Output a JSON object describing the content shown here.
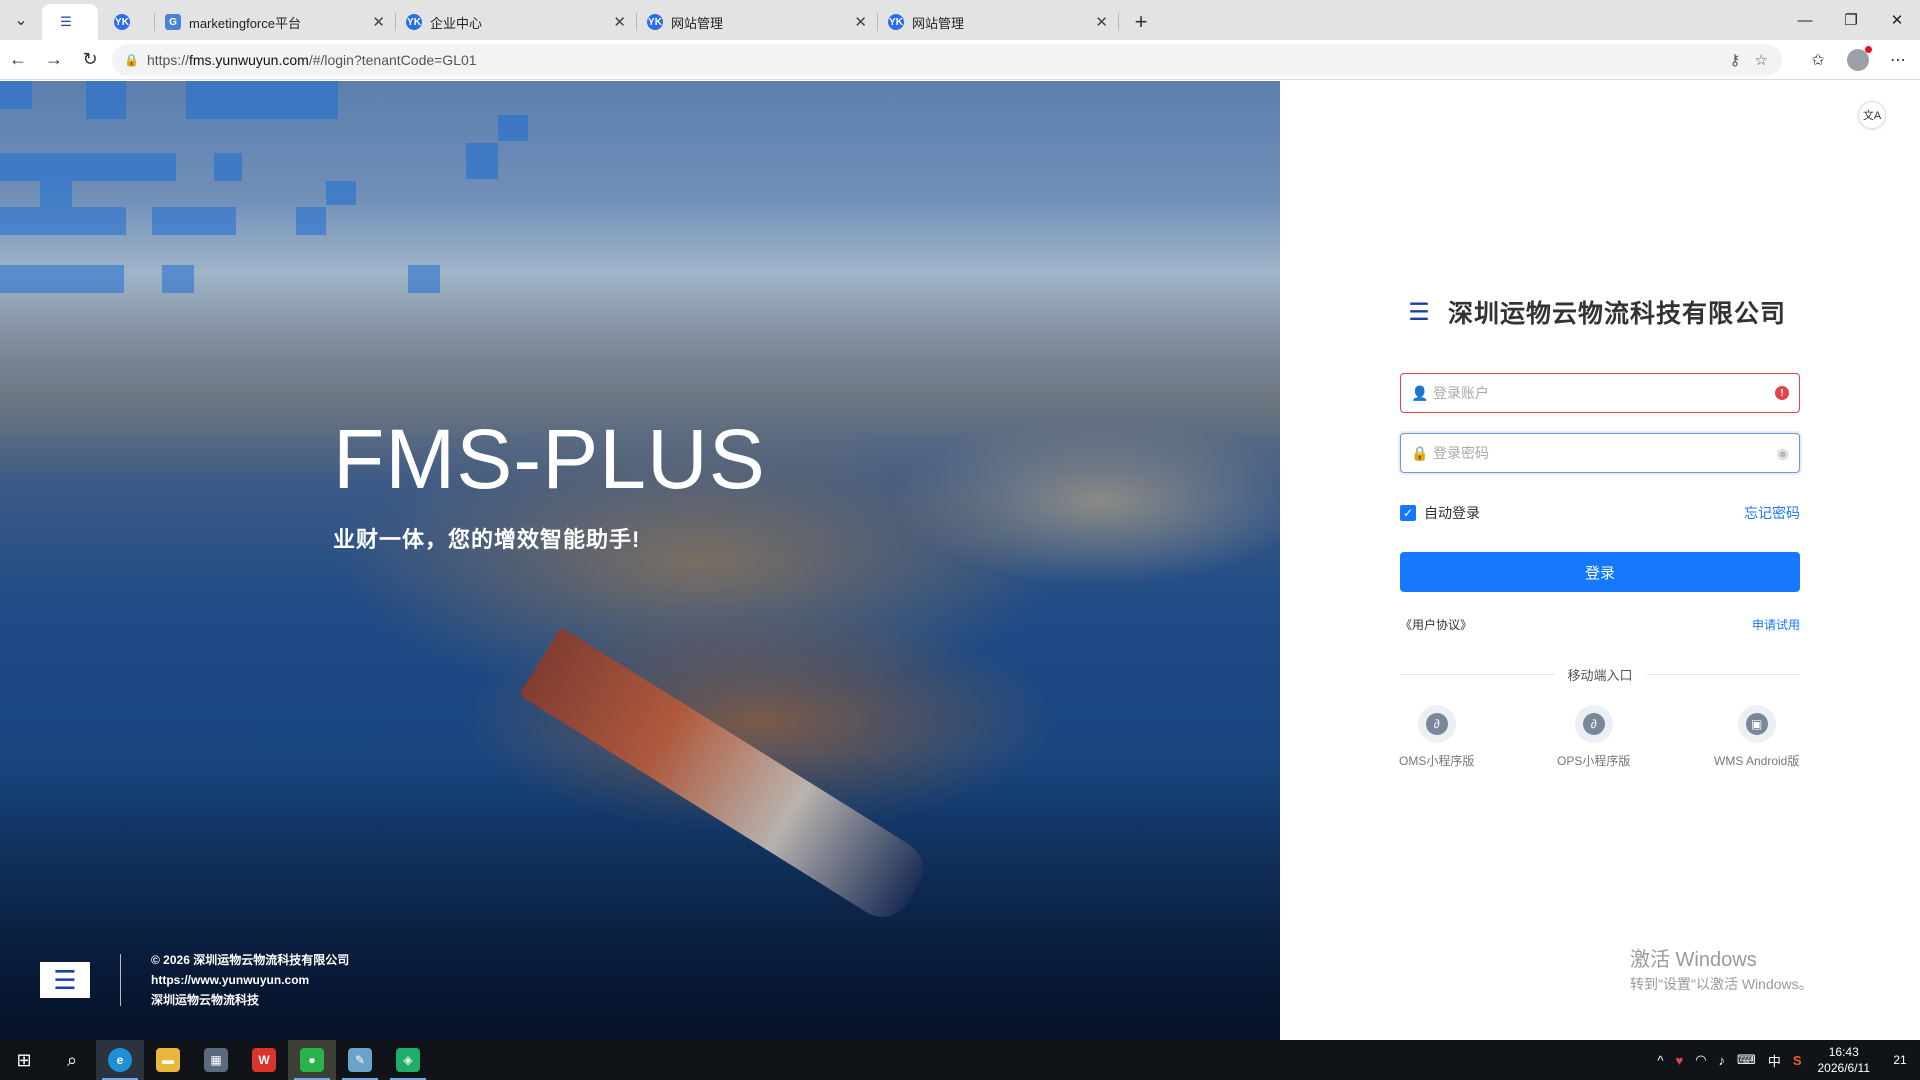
{
  "browser": {
    "tabs": [
      {
        "label": "",
        "favicon": "fms-logo-icon",
        "active": true
      },
      {
        "label": "",
        "favicon": "yk-logo-icon",
        "active": false
      },
      {
        "label": "marketingforce平台",
        "favicon": "gr-logo-icon",
        "active": false
      },
      {
        "label": "企业中心",
        "favicon": "yk-logo-icon",
        "active": false
      },
      {
        "label": "网站管理",
        "favicon": "yk-logo-icon",
        "active": false
      },
      {
        "label": "网站管理",
        "favicon": "yk-logo-icon",
        "active": false
      }
    ],
    "url_prefix": "https://",
    "url_host": "fms.yunwuyun.com",
    "url_path": "/#/login?tenantCode=GL01"
  },
  "hero": {
    "title": "FMS-PLUS",
    "subtitle": "业财一体，您的增效智能助手!",
    "footer": {
      "copyright": "© 2026 深圳运物云物流科技有限公司",
      "website": "https://www.yunwuyun.com",
      "company_short": "深圳运物云物流科技"
    }
  },
  "login": {
    "company_name": "深圳运物云物流科技有限公司",
    "account_placeholder": "登录账户",
    "password_placeholder": "登录密码",
    "remember_label": "自动登录",
    "remember_checked": true,
    "forgot_label": "忘记密码",
    "submit_label": "登录",
    "agreement_label": "《用户协议》",
    "trial_label": "申请试用",
    "mobile_section_label": "移动端入口",
    "mobile_entries": [
      {
        "label": "OMS小程序版",
        "icon": "mini-program-icon"
      },
      {
        "label": "OPS小程序版",
        "icon": "mini-program-icon"
      },
      {
        "label": "WMS Android版",
        "icon": "android-icon"
      }
    ],
    "accent_color": "#1677ff",
    "error_color": "#e0444d"
  },
  "watermark": {
    "line1": "激活 Windows",
    "line2": "转到\"设置\"以激活 Windows。"
  },
  "taskbar": {
    "time": "16:43",
    "date": "2026/6/11",
    "ime": "中",
    "notifications": "21"
  }
}
